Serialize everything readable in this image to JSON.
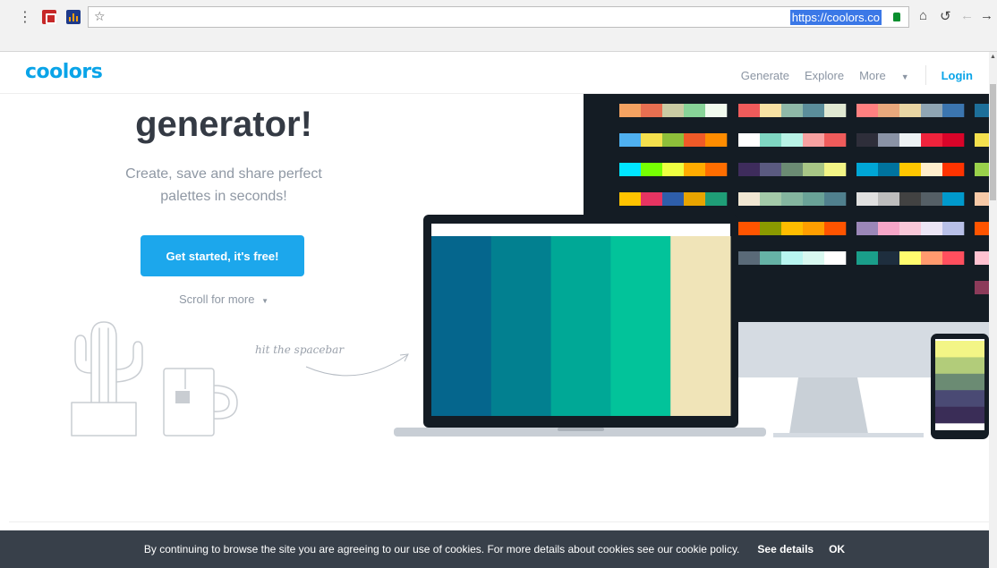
{
  "browser": {
    "url": "https://coolors.co",
    "icons": [
      "more-vert-icon",
      "pdf-extension-icon",
      "chart-extension-icon",
      "bookmark-star-icon",
      "lock-icon",
      "home-icon",
      "reload-icon",
      "back-icon",
      "forward-icon"
    ]
  },
  "header": {
    "logo": "coolors",
    "nav": {
      "generate": "Generate",
      "explore": "Explore",
      "more": "More",
      "login": "Login"
    }
  },
  "hero": {
    "title": "generator!",
    "subtitle_line1": "Create, save and share perfect",
    "subtitle_line2": "palettes in seconds!",
    "cta": "Get started, it's free!",
    "scroll": "Scroll for more",
    "spacebar_hint": "hit the spacebar"
  },
  "laptop_palette": [
    "#05668d",
    "#028090",
    "#00a896",
    "#02c39a",
    "#f0e4b8"
  ],
  "phone_palette": [
    "#f3f586",
    "#b2cc7a",
    "#6b8b73",
    "#4a4a74",
    "#3a2d57"
  ],
  "monitor_palettes": [
    [
      "#f4a261",
      "#e76f51",
      "#c9cba3",
      "#88d498",
      "#f1faee"
    ],
    [
      "#ef5b5b",
      "#f7e1a3",
      "#8fb9a8",
      "#5b8e9b",
      "#e0e8d2"
    ],
    [
      "#ff8080",
      "#e8a87c",
      "#e8d5a3",
      "#8fa5b3",
      "#3b75af"
    ],
    [
      "#4fb0f0",
      "#f4e04d",
      "#8ebf3a",
      "#f05a28",
      "#ff8c00"
    ],
    [
      "#ffffff",
      "#7fd6c2",
      "#b8f2e6",
      "#f7a1a1",
      "#ef5b5b"
    ],
    [
      "#2e2e3a",
      "#8a93a6",
      "#edf2f4",
      "#ef233c",
      "#d90429"
    ],
    [
      "#00e5ff",
      "#76ff03",
      "#eeff41",
      "#ffab00",
      "#ff6d00"
    ],
    [
      "#3e2c5c",
      "#5a5a80",
      "#6b8b73",
      "#a8c686",
      "#f3f586"
    ],
    [
      "#00a6d6",
      "#00739e",
      "#ffc700",
      "#ffeecc",
      "#ff3300"
    ],
    [
      "#ffc300",
      "#e63462",
      "#2e5eaa",
      "#e8a400",
      "#1f9e77"
    ],
    [
      "#f0e6d2",
      "#a3c9a8",
      "#84b59f",
      "#69a297",
      "#50808e"
    ],
    [
      "#e0e0e0",
      "#bdbdbd",
      "#424242",
      "#555f66",
      "#0099cc"
    ],
    [
      "#d8e2dc",
      "#ffe5d9",
      "#ffcad4",
      "#f4acb7",
      "#9d8189"
    ],
    [
      "#ff5400",
      "#8a9a00",
      "#ffbd00",
      "#ff9e00",
      "#ff5400"
    ],
    [
      "#9b87b8",
      "#f6a6c8",
      "#f8c7d8",
      "#ebe5f5",
      "#b8c0e8"
    ],
    [
      "#c5f6e6",
      "#ead1f6",
      "#f7a8c4",
      "#fdeaa8",
      "#a8e6f0"
    ],
    [
      "#5a6a78",
      "#66b2a6",
      "#b8f5f0",
      "#d8f8f0",
      "#ffffff"
    ],
    [
      "#1a9e8a",
      "#1e2e3e",
      "#fffb6e",
      "#ff9a6e",
      "#ff4f5e"
    ]
  ],
  "cookie": {
    "text": "By continuing to browse the site you are agreeing to our use of cookies. For more details about cookies see our cookie policy.",
    "details": "See details",
    "ok": "OK"
  }
}
